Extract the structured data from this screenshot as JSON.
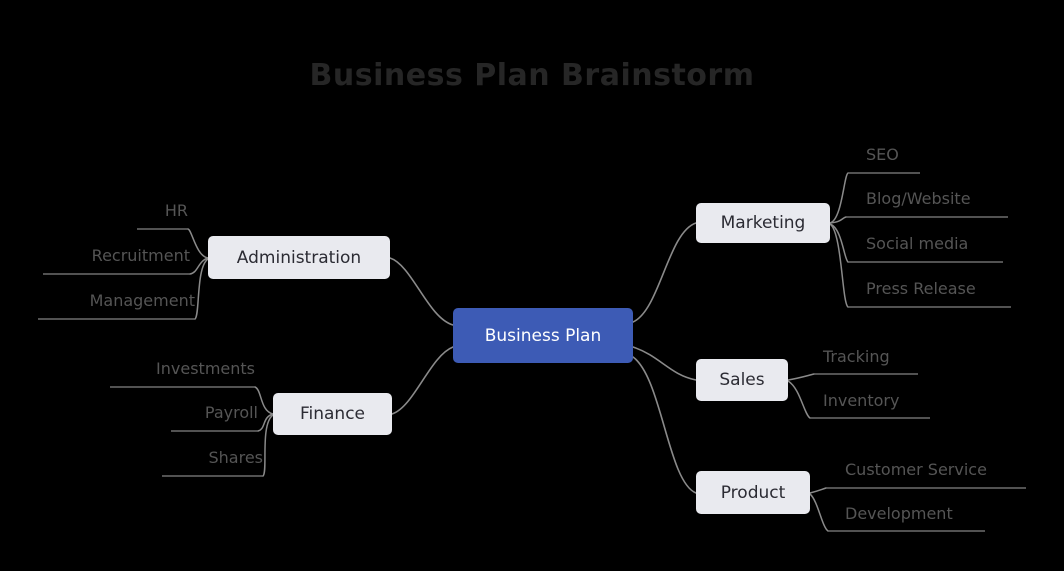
{
  "title": "Business Plan Brainstorm",
  "theme": {
    "background": "#000000",
    "title_color": "#262626",
    "root_fill": "#3d5bb5",
    "root_text": "#ffffff",
    "branch_fill": "#e9eaef",
    "branch_text": "#2b2b33",
    "leaf_text": "#555555",
    "connector": "#8a8a8a",
    "underline": "#6e6e6e"
  },
  "chart_data": {
    "type": "diagram",
    "diagram_type": "mind-map",
    "title": "Business Plan Brainstorm",
    "root": "Business Plan",
    "branches": [
      {
        "name": "Administration",
        "side": "left",
        "children": [
          "HR",
          "Recruitment",
          "Management"
        ]
      },
      {
        "name": "Finance",
        "side": "left",
        "children": [
          "Investments",
          "Payroll",
          "Shares"
        ]
      },
      {
        "name": "Marketing",
        "side": "right",
        "children": [
          "SEO",
          "Blog/Website",
          "Social media",
          "Press Release"
        ]
      },
      {
        "name": "Sales",
        "side": "right",
        "children": [
          "Tracking",
          "Inventory"
        ]
      },
      {
        "name": "Product",
        "side": "right",
        "children": [
          "Customer Service",
          "Development"
        ]
      }
    ]
  },
  "root": {
    "label": "Business Plan"
  },
  "branches": {
    "administration": {
      "label": "Administration"
    },
    "finance": {
      "label": "Finance"
    },
    "marketing": {
      "label": "Marketing"
    },
    "sales": {
      "label": "Sales"
    },
    "product": {
      "label": "Product"
    }
  },
  "leaves": {
    "hr": {
      "label": "HR"
    },
    "recruitment": {
      "label": "Recruitment"
    },
    "management": {
      "label": "Management"
    },
    "investments": {
      "label": "Investments"
    },
    "payroll": {
      "label": "Payroll"
    },
    "shares": {
      "label": "Shares"
    },
    "seo": {
      "label": "SEO"
    },
    "blog_website": {
      "label": "Blog/Website"
    },
    "social_media": {
      "label": "Social media"
    },
    "press_release": {
      "label": "Press Release"
    },
    "tracking": {
      "label": "Tracking"
    },
    "inventory": {
      "label": "Inventory"
    },
    "customer_service": {
      "label": "Customer Service"
    },
    "development": {
      "label": "Development"
    }
  }
}
